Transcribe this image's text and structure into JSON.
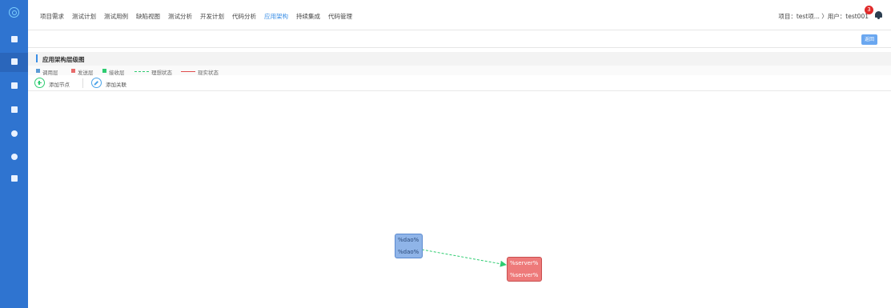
{
  "nav": {
    "items": [
      "项目需求",
      "测试计划",
      "测试用例",
      "缺陷视图",
      "测试分析",
      "开发计划",
      "代码分析",
      "应用架构",
      "持续集成",
      "代码管理"
    ],
    "active_index": 7
  },
  "header": {
    "project_user": "项目：test项... 〉用户：test001",
    "notification_count": "3"
  },
  "toolbar": {
    "back_label": "返回"
  },
  "panel": {
    "title": "应用架构层级图"
  },
  "legend": {
    "items": [
      {
        "label": "调用层",
        "color": "#5b9bd5"
      },
      {
        "label": "发送层",
        "color": "#e86b6b"
      },
      {
        "label": "接收层",
        "color": "#2ecc71"
      },
      {
        "label": "理想状态",
        "style": "dashed",
        "color": "#2ecc71"
      },
      {
        "label": "现实状态",
        "style": "solid",
        "color": "#e04d4d"
      }
    ]
  },
  "actions": {
    "add_node": "添加节点",
    "add_link": "添加关联"
  },
  "graph": {
    "nodes": [
      {
        "id": "dao",
        "lines": [
          "%dao%",
          "%dao%"
        ],
        "type": "call"
      },
      {
        "id": "server",
        "lines": [
          "%server%",
          "%server%"
        ],
        "type": "send"
      }
    ],
    "edges": [
      {
        "from": "dao",
        "to": "server",
        "style": "dashed",
        "color": "#2ecc71"
      }
    ]
  },
  "colors": {
    "sidebar": "#2f74d0",
    "accent": "#3a8ee6",
    "badge": "#e02a2a"
  }
}
